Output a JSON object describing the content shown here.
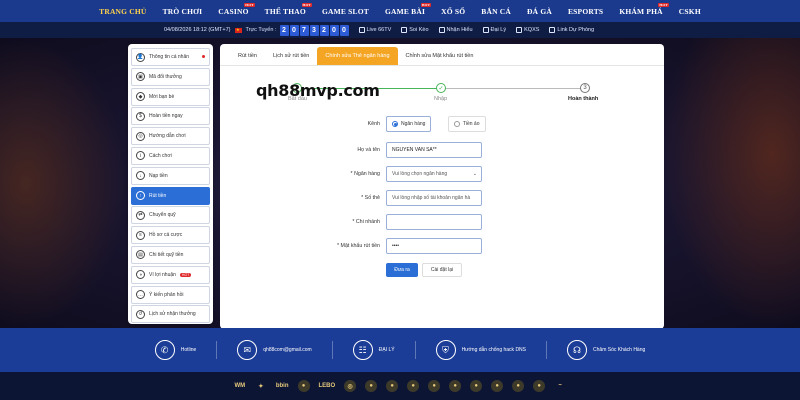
{
  "nav": {
    "items": [
      {
        "label": "TRANG CHỦ",
        "badge": ""
      },
      {
        "label": "TRÒ CHƠI",
        "badge": ""
      },
      {
        "label": "CASINO",
        "badge": "HOT"
      },
      {
        "label": "THỂ THAO",
        "badge": "HOT"
      },
      {
        "label": "GAME SLOT",
        "badge": ""
      },
      {
        "label": "GAME BÀI",
        "badge": "HOT"
      },
      {
        "label": "XỔ SỐ",
        "badge": ""
      },
      {
        "label": "BẮN CÁ",
        "badge": ""
      },
      {
        "label": "ĐÁ GÀ",
        "badge": ""
      },
      {
        "label": "ESPORTS",
        "badge": ""
      },
      {
        "label": "KHÁM PHÁ",
        "badge": "HOT"
      },
      {
        "label": "CSKH",
        "badge": ""
      }
    ]
  },
  "infobar": {
    "datetime": "04/08/2026 18:12 (GMT+7)",
    "online_label": "Trực Tuyến :",
    "online_digits": [
      "2",
      "0",
      "7",
      "3",
      "2",
      "0",
      "0"
    ],
    "links": [
      "Live 66TV",
      "Soi Kèo",
      "Nhận Hiểu",
      "Đại Lý",
      "KQXS",
      "Link Dự Phòng"
    ]
  },
  "sidebar": {
    "items": [
      {
        "label": "Thông tin cá nhân",
        "icon": "user-icon",
        "dot": true,
        "active": false
      },
      {
        "label": "Mã đổi thưởng",
        "icon": "gift-icon",
        "active": false
      },
      {
        "label": "Mời bạn bè",
        "icon": "diamond-icon",
        "active": false
      },
      {
        "label": "Hoàn tiền ngay",
        "icon": "refund-icon",
        "active": false
      },
      {
        "label": "Hướng dẫn chơi",
        "icon": "gamepad-icon",
        "active": false
      },
      {
        "label": "Cách chơi",
        "icon": "info-icon",
        "active": false
      },
      {
        "label": "Nạp tiền",
        "icon": "deposit-icon",
        "active": false
      },
      {
        "label": "Rút tiền",
        "icon": "withdraw-icon",
        "active": true
      },
      {
        "label": "Chuyển quỹ",
        "icon": "transfer-icon",
        "active": false
      },
      {
        "label": "Hồ sơ cá cược",
        "icon": "record-icon",
        "active": false
      },
      {
        "label": "Chi tiết quỹ tiền",
        "icon": "ledger-icon",
        "active": false
      },
      {
        "label": "Ví lợi nhuận",
        "icon": "wallet-icon",
        "hot": "HOT",
        "active": false
      },
      {
        "label": "Ý kiến phản hồi",
        "icon": "feedback-icon",
        "active": false
      },
      {
        "label": "Lịch sử nhận thưởng",
        "icon": "history-icon",
        "active": false
      }
    ]
  },
  "tabs": [
    "Rút tiền",
    "Lịch sử rút tiền",
    "Chính sửa Thẻ ngân hàng",
    "Chỉnh sửa Mật khẩu rút tiền"
  ],
  "overlay_text": "qh88mvp.com",
  "steps": [
    {
      "label": "Bắt đầu"
    },
    {
      "label": "Nhập"
    },
    {
      "label": "Hoàn thành",
      "number": "3"
    }
  ],
  "form": {
    "kenh_label": "Kênh",
    "kenh_opt1": "Ngân hàng",
    "kenh_opt2": "Tiền ảo",
    "name_label": "Họ và tên",
    "name_value": "NGUYEN VAN SA**",
    "bank_label": "* Ngân hàng",
    "bank_placeholder": "Vui lòng chọn ngân hàng",
    "card_label": "* Số thẻ",
    "card_placeholder": "Vui lòng nhập số tài khoản ngân hà",
    "branch_label": "* Chi nhánh",
    "branch_value": "",
    "pwd_label": "* Mật khẩu rút tiền",
    "pwd_value": "••••",
    "submit_label": "Đưa ra",
    "reset_label": "Cài đặt lại"
  },
  "footer": {
    "items": [
      {
        "label": "Hotline",
        "icon": "phone-icon"
      },
      {
        "label": "qh88com@gmail.com",
        "icon": "mail-icon"
      },
      {
        "label": "ĐẠI LÝ",
        "icon": "handshake-icon"
      },
      {
        "label": "Hướng dẫn chống hack DNS",
        "icon": "shield-icon"
      },
      {
        "label": "Chăm Sóc Khách Hàng",
        "icon": "headset-icon"
      }
    ]
  },
  "partners": [
    "WM",
    "✦",
    "bbin",
    "●",
    "LEBO",
    "◎",
    "●",
    "●",
    "●",
    "●",
    "●",
    "●",
    "●",
    "●",
    "●",
    "~"
  ]
}
